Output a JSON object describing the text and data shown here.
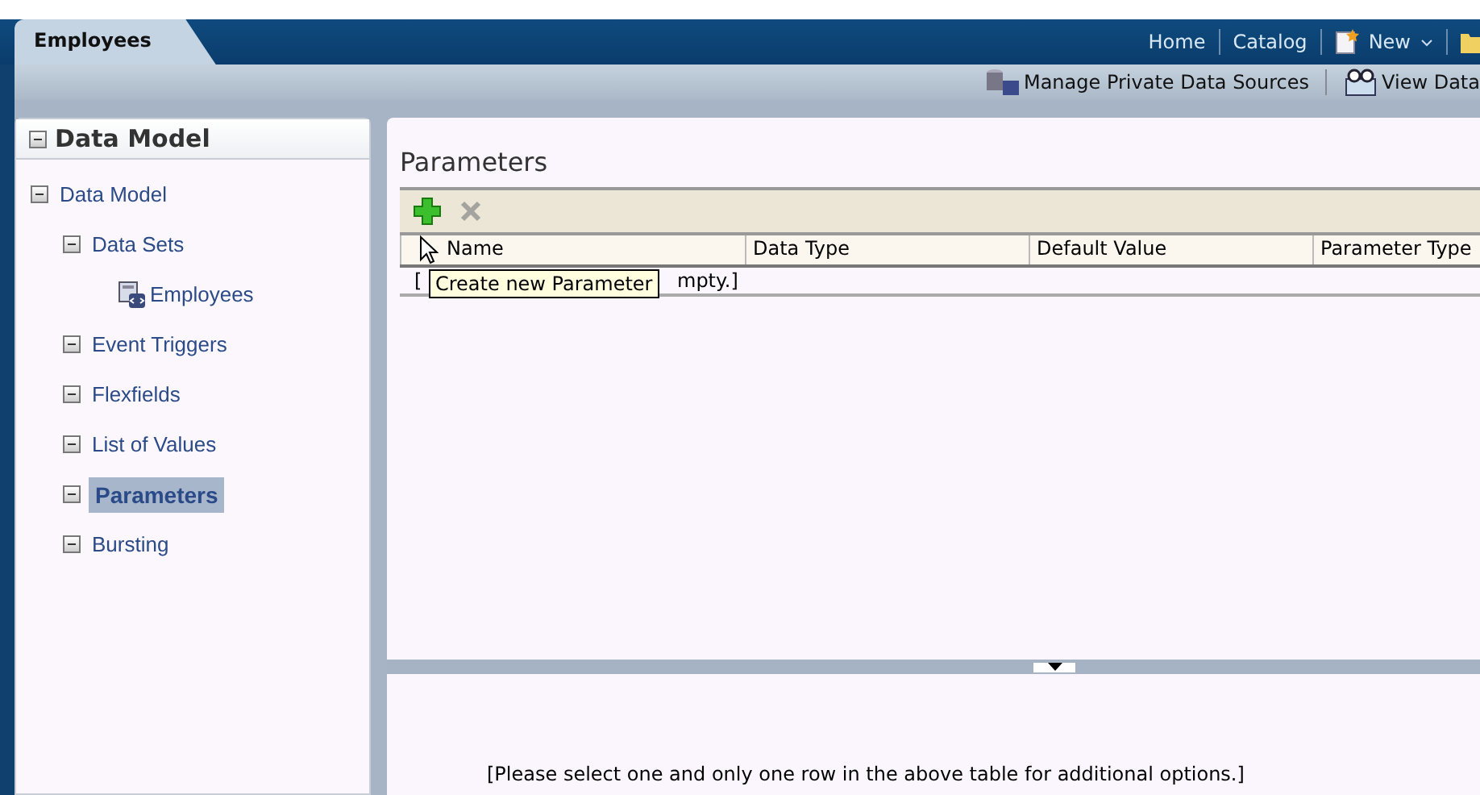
{
  "app_tab": {
    "label": "Employees",
    "selected": true
  },
  "global_links": [
    {
      "kind": "link",
      "label": "Home"
    },
    {
      "kind": "link",
      "label": "Catalog"
    },
    {
      "kind": "menu",
      "label": "New"
    },
    {
      "kind": "folder"
    }
  ],
  "toolbar": [
    {
      "kind": "datasource",
      "label": "Manage Private Data Sources"
    },
    {
      "kind": "viewdata",
      "label": "View Data"
    }
  ],
  "sidebar": {
    "title": "Data Model",
    "items": [
      {
        "label": "Data Model",
        "selected": false,
        "children": [
          {
            "label": "Data Sets",
            "selected": false,
            "children": [
              {
                "label": "Employees",
                "kind": "dataset",
                "selected": false
              }
            ]
          },
          {
            "label": "Event Triggers",
            "selected": false
          },
          {
            "label": "Flexfields",
            "selected": false
          },
          {
            "label": "List of Values",
            "selected": false
          },
          {
            "label": "Parameters",
            "selected": true
          },
          {
            "label": "Bursting",
            "selected": false
          }
        ]
      }
    ]
  },
  "panel": {
    "title": "Parameters",
    "actions": [
      {
        "kind": "add",
        "disabled": false
      },
      {
        "kind": "delete",
        "disabled": true
      }
    ],
    "columns": [
      "Name",
      "Data Type",
      "Default Value",
      "Parameter Type"
    ],
    "empty_row": [
      "[",
      "mpty.]"
    ],
    "tooltip": "Create new Parameter",
    "message": "[Please select one and only one row in the above table for additional options.]"
  }
}
